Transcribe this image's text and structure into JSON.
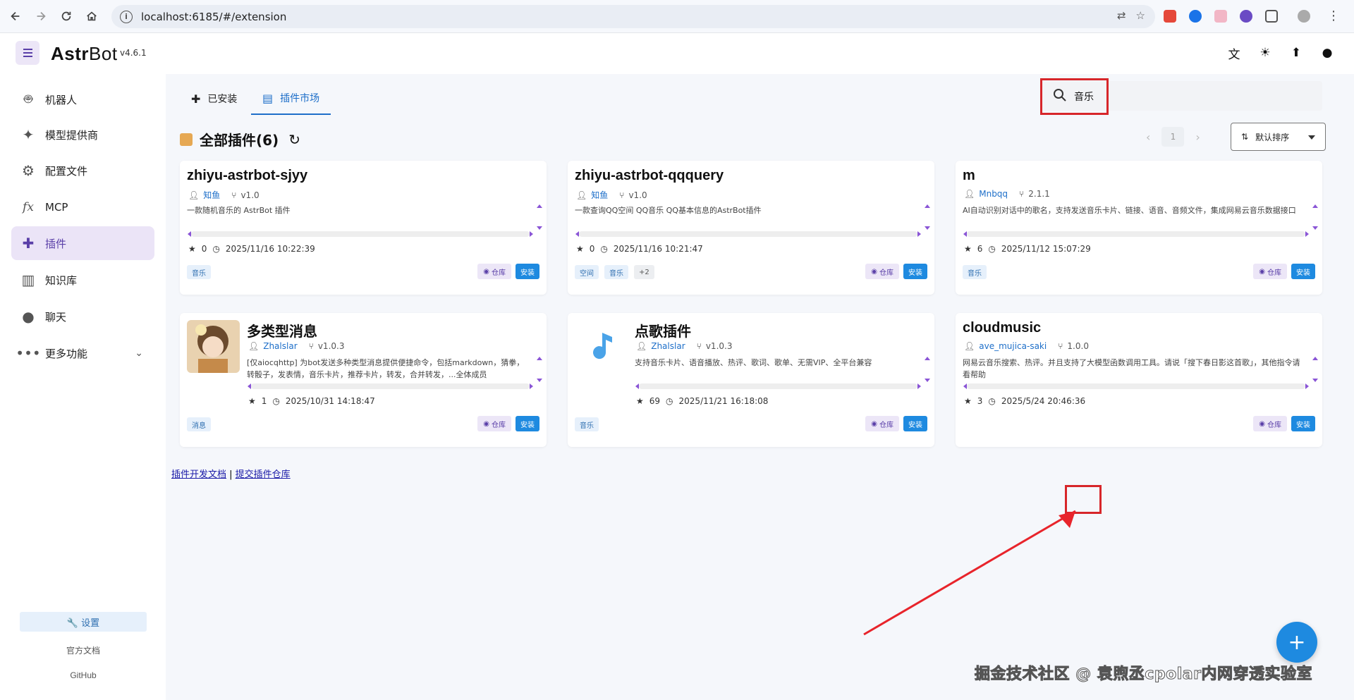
{
  "browser": {
    "url": "localhost:6185/#/extension"
  },
  "app": {
    "brand_bold": "Astr",
    "brand_rest": "Bot",
    "version": "v4.6.1"
  },
  "sidebar": {
    "items": [
      {
        "label": "机器人",
        "icon": "robot-icon"
      },
      {
        "label": "模型提供商",
        "icon": "sparkle-icon"
      },
      {
        "label": "配置文件",
        "icon": "gear-icon"
      },
      {
        "label": "MCP",
        "icon": "function-icon"
      },
      {
        "label": "插件",
        "icon": "puzzle-icon"
      },
      {
        "label": "知识库",
        "icon": "book-icon"
      },
      {
        "label": "聊天",
        "icon": "chat-icon"
      },
      {
        "label": "更多功能",
        "icon": "more-icon"
      }
    ],
    "settings": "🔧 设置",
    "docs": "官方文档",
    "github": "GitHub"
  },
  "tabs": {
    "installed": "已安装",
    "market": "插件市场"
  },
  "search": {
    "value": "音乐"
  },
  "section": {
    "title": "全部插件(6)"
  },
  "pager": {
    "page": "1"
  },
  "sort": {
    "label": "默认排序"
  },
  "cards": [
    {
      "name": "zhiyu-astrbot-sjyy",
      "author": "知鱼",
      "version": "v1.0",
      "desc": "一款随机音乐的 AstrBot 插件",
      "stars": "0",
      "date": "2025/11/16 10:22:39",
      "tags": [
        "音乐"
      ],
      "repo": "仓库",
      "install": "安装"
    },
    {
      "name": "zhiyu-astrbot-qqquery",
      "author": "知鱼",
      "version": "v1.0",
      "desc": "一款查询QQ空间 QQ音乐 QQ基本信息的AstrBot插件",
      "stars": "0",
      "date": "2025/11/16 10:21:47",
      "tags": [
        "空间",
        "音乐",
        "+2"
      ],
      "repo": "仓库",
      "install": "安装"
    },
    {
      "name": "m",
      "author": "Mnbqq",
      "version": "2.1.1",
      "desc": "AI自动识别对话中的歌名，支持发送音乐卡片、链接、语音、音频文件，集成网易云音乐数据接口",
      "stars": "6",
      "date": "2025/11/12 15:07:29",
      "tags": [
        "音乐"
      ],
      "repo": "仓库",
      "install": "安装"
    },
    {
      "name": "多类型消息",
      "author": "Zhalslar",
      "version": "v1.0.3",
      "desc": "[仅aiocqhttp] 为bot发送多种类型消息提供便捷命令，包括markdown，猜拳，转骰子，发表情，音乐卡片，推荐卡片，转发，合并转发，...全体成员",
      "stars": "1",
      "date": "2025/10/31 14:18:47",
      "tags": [
        "消息"
      ],
      "repo": "仓库",
      "install": "安装"
    },
    {
      "name": "点歌插件",
      "author": "Zhalslar",
      "version": "v1.0.3",
      "desc": "支持音乐卡片、语音播放、热评、歌词、歌单、无需VIP、全平台兼容",
      "stars": "69",
      "date": "2025/11/21 16:18:08",
      "tags": [
        "音乐"
      ],
      "repo": "仓库",
      "install": "安装"
    },
    {
      "name": "cloudmusic",
      "author": "ave_mujica-saki",
      "version": "1.0.0",
      "desc": "网易云音乐搜索、热评。并且支持了大模型函数调用工具。请说「搜下春日影这首歌」，其他指令请看帮助",
      "stars": "3",
      "date": "2025/5/24 20:46:36",
      "tags": [],
      "repo": "仓库",
      "install": "安装"
    }
  ],
  "footer": {
    "dev_docs": "插件开发文档",
    "separator": " | ",
    "submit": "提交插件仓库"
  },
  "watermark": "掘金技术社区 @ 袁煦丞cpolar内网穿透实验室",
  "colors": {
    "accent": "#5a3fa8",
    "primary": "#1e8ae0",
    "highlight": "#d7262a"
  }
}
